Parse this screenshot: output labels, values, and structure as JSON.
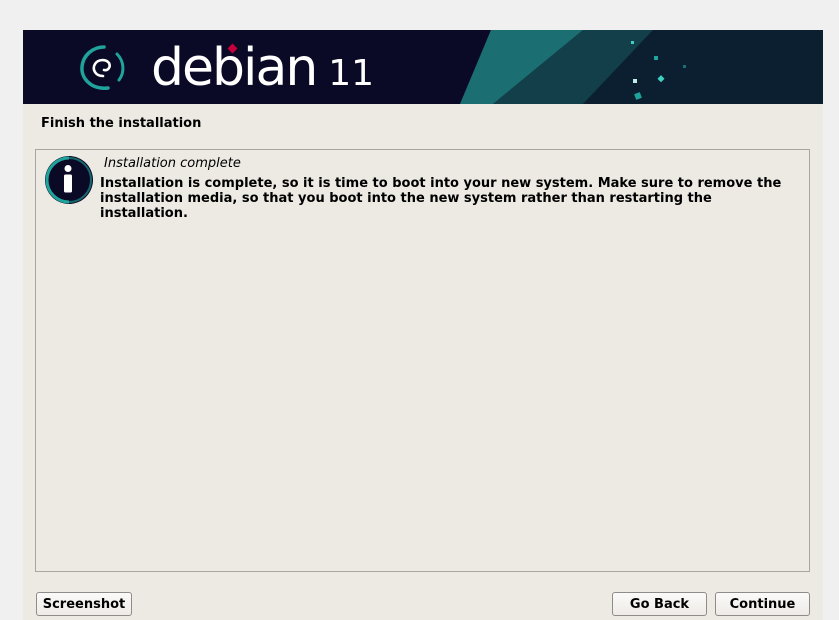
{
  "banner": {
    "logo_icon": "debian-swirl-icon",
    "wordmark": "debian",
    "version": "11",
    "colors": {
      "background": "#0a0a26",
      "swirl": "#1fa39b",
      "accent": "#c7003b"
    }
  },
  "step_title": "Finish the installation",
  "message": {
    "icon": "info-icon",
    "title": "Installation complete",
    "body": "Installation is complete, so it is time to boot into your new system. Make sure to remove the installation media, so that you boot into the new system rather than restarting the installation."
  },
  "buttons": {
    "screenshot": "Screenshot",
    "go_back": "Go Back",
    "continue": "Continue"
  }
}
